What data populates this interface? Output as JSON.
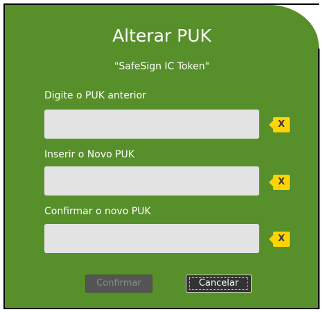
{
  "dialog": {
    "title": "Alterar PUK",
    "subtitle": "\"SafeSign IC Token\"",
    "fields": [
      {
        "label": "Digite o PUK anterior",
        "value": "",
        "clear_label": "X"
      },
      {
        "label": "Inserir o Novo PUK",
        "value": "",
        "clear_label": "X"
      },
      {
        "label": "Confirmar o novo PUK",
        "value": "",
        "clear_label": "X"
      }
    ],
    "buttons": {
      "confirm_label": "Confirmar",
      "cancel_label": "Cancelar"
    }
  },
  "colors": {
    "background": "#57902a",
    "input": "#e3e3e3",
    "clear_button": "#ffd400",
    "text": "#ffffff"
  }
}
